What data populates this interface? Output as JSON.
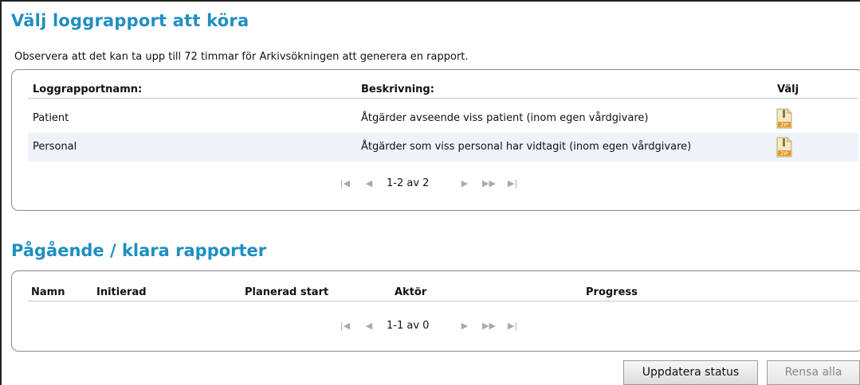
{
  "section1": {
    "title": "Välj loggrapport att köra",
    "note": "Observera att det kan ta upp till 72 timmar för Arkivsökningen att generera en rapport.",
    "columns": {
      "name": "Loggrapportnamn:",
      "desc": "Beskrivning:",
      "choose": "Välj"
    },
    "rows": [
      {
        "name": "Patient",
        "desc": "Åtgärder avseende viss patient (inom egen vårdgivare)",
        "icon": "zip-file-icon"
      },
      {
        "name": "Personal",
        "desc": "Åtgärder som viss personal har vidtagit (inom egen vårdgivare)",
        "icon": "zip-file-icon"
      }
    ],
    "pager": {
      "text": "1-2 av 2"
    }
  },
  "section2": {
    "title": "Pågående / klara rapporter",
    "columns": {
      "name": "Namn",
      "initiated": "Initierad",
      "planned": "Planerad start",
      "actor": "Aktör",
      "progress": "Progress"
    },
    "pager": {
      "text": "1-1 av 0"
    }
  },
  "buttons": {
    "update": "Uppdatera status",
    "clear": "Rensa alla"
  },
  "colors": {
    "heading": "#1f8fc1",
    "row_alt": "#eef3fa"
  }
}
